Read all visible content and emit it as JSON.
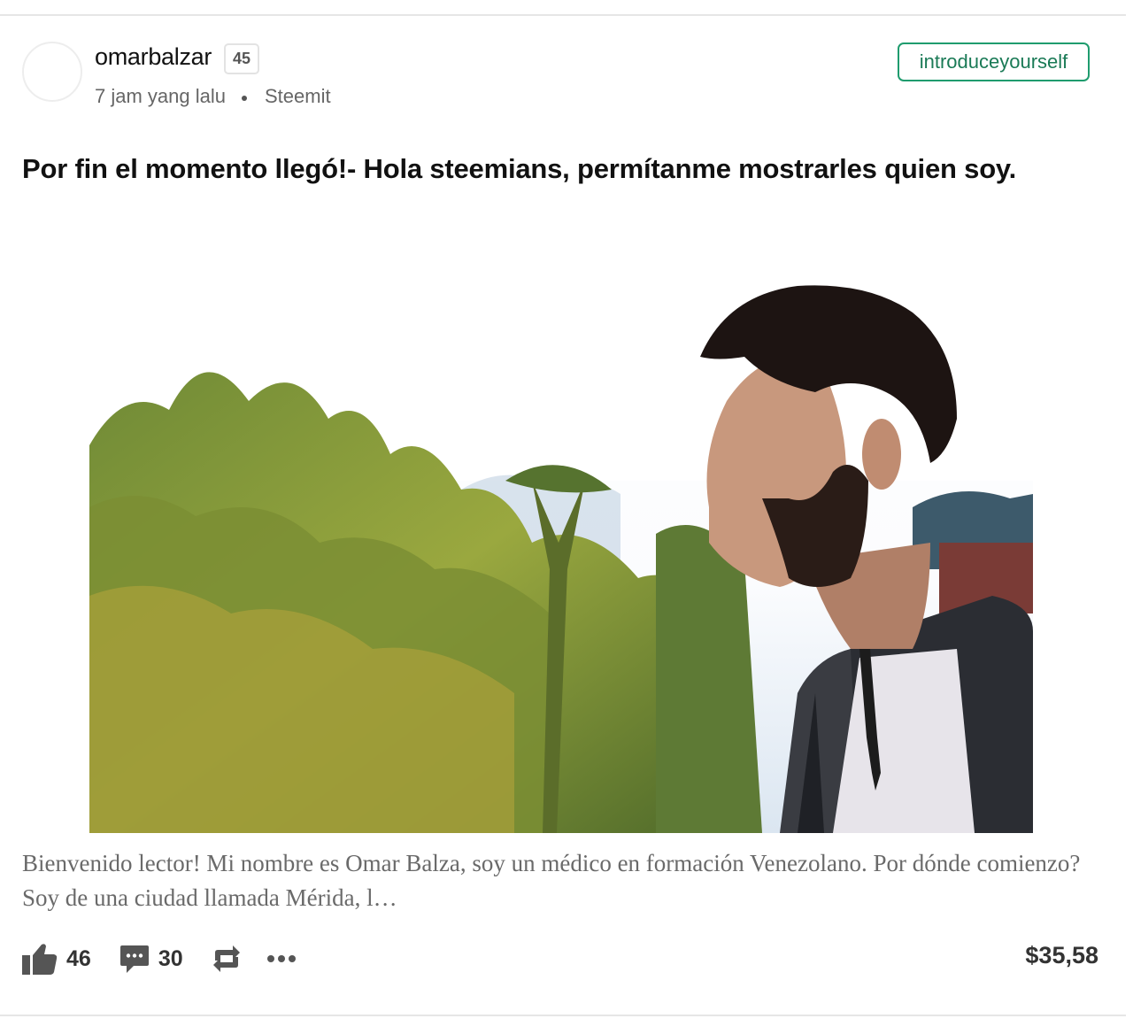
{
  "post": {
    "author": "omarbalzar",
    "reputation": "45",
    "time": "7 jam yang lalu",
    "source": "Steemit",
    "tag": "introduceyourself",
    "title": "Por fin el momento llegó!- Hola steemians, permítanme mostrarles quien soy.",
    "excerpt": "Bienvenido lector! Mi nombre es Omar Balza, soy un médico en formación Venezolano. Por dónde comienzo? Soy de una ciudad llamada Mérida, l…",
    "votes": "46",
    "comments": "30",
    "payout": "$35,58"
  },
  "icons": {
    "upvote": "thumbs-up-icon",
    "comments": "comment-bubble-icon",
    "resteem": "resteem-arrows-icon",
    "more": "more-dots-icon"
  },
  "colors": {
    "tag_border": "#1f9c6e",
    "tag_text": "#1a7a56",
    "text_muted": "#6a6a6a"
  }
}
